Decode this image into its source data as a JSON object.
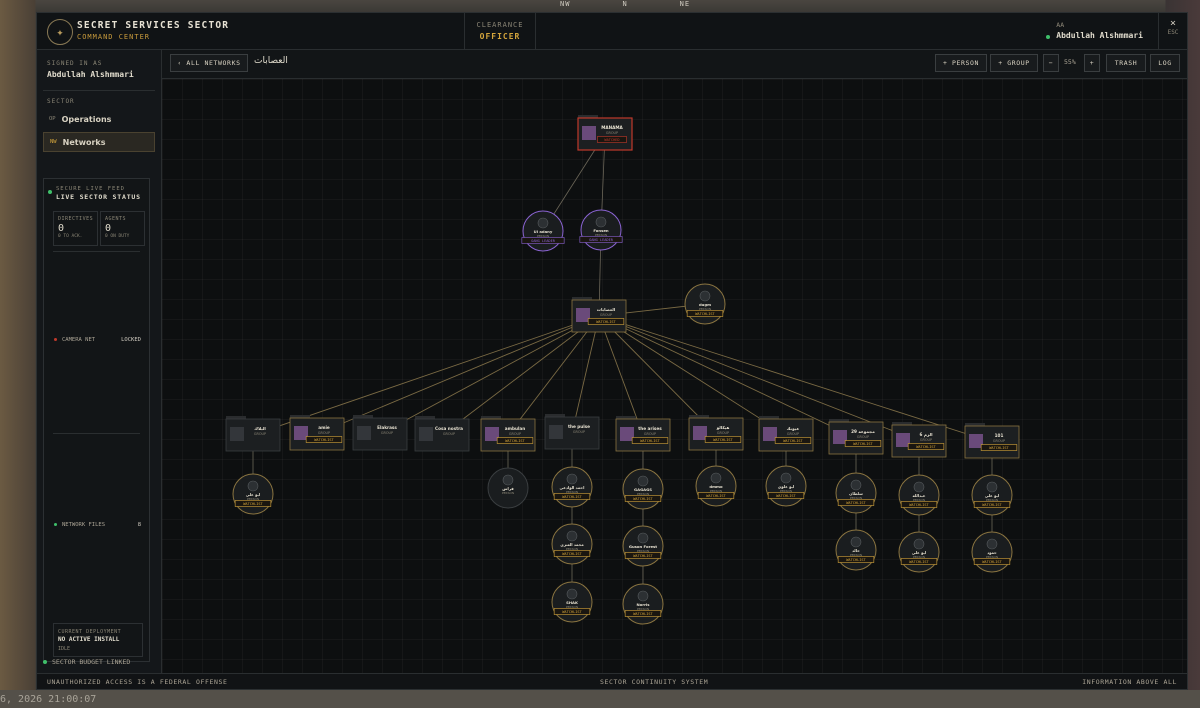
{
  "app": {
    "title": "SECRET SERVICES SECTOR",
    "subtitle": "COMMAND CENTER",
    "clearance_label": "CLEARANCE",
    "clearance_value": "OFFICER",
    "user_initials": "AA",
    "user_name": "Abdullah Alshmmari",
    "esc_label": "ESC",
    "close_glyph": "×"
  },
  "background": {
    "timestamp": "6, 2026 21:00:07",
    "compass": [
      "NW",
      "N",
      "NE"
    ]
  },
  "sidebar": {
    "signed_in_label": "SIGNED IN AS",
    "signed_in_name": "Abdullah Alshmmari",
    "sector_label": "SECTOR",
    "items": [
      {
        "icon": "OP",
        "label": "Operations"
      },
      {
        "icon": "NW",
        "label": "Networks"
      }
    ],
    "status": {
      "eyebrow": "SECURE LIVE FEED",
      "title": "LIVE SECTOR STATUS",
      "directives": {
        "label": "DIRECTIVES",
        "value": "0",
        "sub": "0 TO ACK."
      },
      "agents": {
        "label": "AGENTS",
        "value": "0",
        "sub": "0 ON DUTY"
      },
      "camera": {
        "label": "CAMERA NET",
        "value": "LOCKED"
      },
      "files": {
        "label": "NETWORK FILES",
        "value": "8"
      },
      "deploy": {
        "label": "CURRENT DEPLOYMENT",
        "value": "NO ACTIVE INSTALL",
        "sub": "IDLE"
      }
    },
    "budget": "SECTOR BUDGET LINKED"
  },
  "toolbar": {
    "all_networks": "‹ ALL NETWORKS",
    "crumb": "العصابات",
    "person": "+ PERSON",
    "group": "+ GROUP",
    "zoom_out": "−",
    "zoom": "55%",
    "zoom_in": "+",
    "trash": "TRASH",
    "log": "LOG"
  },
  "footer": {
    "left": "UNAUTHORIZED ACCESS IS A FEDERAL OFFENSE",
    "center": "SECTOR CONTINUITY SYSTEM",
    "right": "INFORMATION ABOVE ALL"
  },
  "colors": {
    "accent": "#d4a53b",
    "danger": "#c0392b",
    "leader": "#8a63d2",
    "ok": "#3fbf6a"
  },
  "graph": {
    "nodes": [
      {
        "id": "root",
        "kind": "group",
        "name": "MANAMA",
        "sub": "GROUP",
        "tag": "WATCHED",
        "red": true
      },
      {
        "id": "p1",
        "kind": "person",
        "name": "Ul adany",
        "sub": "PERSON",
        "tag": "GANG LEADER",
        "tagType": "leader"
      },
      {
        "id": "p2",
        "kind": "person",
        "name": "Fonsen",
        "sub": "PERSON",
        "tag": "GANG LEADER",
        "tagType": "leader"
      },
      {
        "id": "hub",
        "kind": "group",
        "name": "العصابات",
        "sub": "GROUP",
        "tag": "WATCHLIST"
      },
      {
        "id": "pr",
        "kind": "person",
        "name": "dugm",
        "sub": "PERSON",
        "tag": "WATCHLIST"
      },
      {
        "id": "g1",
        "kind": "group",
        "name": "البلاك",
        "sub": "GROUP",
        "tag": ""
      },
      {
        "id": "g2",
        "kind": "group",
        "name": "amie",
        "sub": "GROUP",
        "tag": "WATCHLIST"
      },
      {
        "id": "g3",
        "kind": "group",
        "name": "Elakrass",
        "sub": "GROUP",
        "tag": ""
      },
      {
        "id": "g4",
        "kind": "group",
        "name": "Cosa nostra",
        "sub": "GROUP",
        "tag": ""
      },
      {
        "id": "g5",
        "kind": "group",
        "name": "ambulan",
        "sub": "GROUP",
        "tag": "WATCHLIST"
      },
      {
        "id": "g6",
        "kind": "group",
        "name": "the pulse",
        "sub": "GROUP",
        "tag": ""
      },
      {
        "id": "g7",
        "kind": "group",
        "name": "the arises",
        "sub": "GROUP",
        "tag": "WATCHLIST"
      },
      {
        "id": "g8",
        "kind": "group",
        "name": "هيكالو",
        "sub": "GROUP",
        "tag": "WATCHLIST"
      },
      {
        "id": "g9",
        "kind": "group",
        "name": "عيونك",
        "sub": "GROUP",
        "tag": "WATCHLIST"
      },
      {
        "id": "g10",
        "kind": "group",
        "name": "مجموعة 29",
        "sub": "GROUP",
        "tag": "WATCHLIST"
      },
      {
        "id": "g11",
        "kind": "group",
        "name": "6 الرم",
        "sub": "GROUP",
        "tag": "WATCHLIST"
      },
      {
        "id": "g12",
        "kind": "group",
        "name": "101",
        "sub": "GROUP",
        "tag": "WATCHLIST"
      },
      {
        "id": "c1",
        "kind": "person",
        "name": "ابو علي",
        "sub": "PERSON",
        "tag": "WATCHLIST"
      },
      {
        "id": "c5",
        "kind": "person",
        "name": "فراس",
        "sub": "PERSON",
        "tag": ""
      },
      {
        "id": "c6a",
        "kind": "person",
        "name": "احمد الوادعي",
        "sub": "PERSON",
        "tag": "WATCHLIST"
      },
      {
        "id": "c6b",
        "kind": "person",
        "name": "محمد العنزي",
        "sub": "PERSON",
        "tag": "WATCHLIST"
      },
      {
        "id": "c6c",
        "kind": "person",
        "name": "SHAK",
        "sub": "PERSON",
        "tag": "WATCHLIST"
      },
      {
        "id": "c7a",
        "kind": "person",
        "name": "GAGAGS",
        "sub": "PERSON",
        "tag": "WATCHLIST"
      },
      {
        "id": "c7b",
        "kind": "person",
        "name": "Guson Forest",
        "sub": "PERSON",
        "tag": "WATCHLIST"
      },
      {
        "id": "c7c",
        "kind": "person",
        "name": "Norris",
        "sub": "PERSON",
        "tag": "WATCHLIST"
      },
      {
        "id": "c8",
        "kind": "person",
        "name": "dmmo",
        "sub": "PERSON",
        "tag": "WATCHLIST"
      },
      {
        "id": "c9",
        "kind": "person",
        "name": "ابو علوي",
        "sub": "PERSON",
        "tag": "WATCHLIST"
      },
      {
        "id": "c10a",
        "kind": "person",
        "name": "سلطان",
        "sub": "PERSON",
        "tag": "WATCHLIST"
      },
      {
        "id": "c10b",
        "kind": "person",
        "name": "خالد",
        "sub": "PERSON",
        "tag": "WATCHLIST"
      },
      {
        "id": "c11a",
        "kind": "person",
        "name": "عبدالله",
        "sub": "PERSON",
        "tag": "WATCHLIST"
      },
      {
        "id": "c11b",
        "kind": "person",
        "name": "ابو علي",
        "sub": "PERSON",
        "tag": "WATCHLIST"
      },
      {
        "id": "c12a",
        "kind": "person",
        "name": "ابو علي",
        "sub": "PERSON",
        "tag": "WATCHLIST"
      },
      {
        "id": "c12b",
        "kind": "person",
        "name": "حمود",
        "sub": "PERSON",
        "tag": "WATCHLIST"
      }
    ],
    "edges": [
      [
        "root",
        "p1"
      ],
      [
        "root",
        "p2"
      ],
      [
        "p2",
        "hub"
      ],
      [
        "hub",
        "pr"
      ],
      [
        "hub",
        "g1"
      ],
      [
        "hub",
        "g2"
      ],
      [
        "hub",
        "g3"
      ],
      [
        "hub",
        "g4"
      ],
      [
        "hub",
        "g5"
      ],
      [
        "hub",
        "g6"
      ],
      [
        "hub",
        "g7"
      ],
      [
        "hub",
        "g8"
      ],
      [
        "hub",
        "g9"
      ],
      [
        "hub",
        "g10"
      ],
      [
        "hub",
        "g11"
      ],
      [
        "hub",
        "g12"
      ],
      [
        "g1",
        "c1"
      ],
      [
        "g5",
        "c5"
      ],
      [
        "g6",
        "c6a"
      ],
      [
        "c6a",
        "c6b"
      ],
      [
        "c6b",
        "c6c"
      ],
      [
        "g7",
        "c7a"
      ],
      [
        "c7a",
        "c7b"
      ],
      [
        "c7b",
        "c7c"
      ],
      [
        "g8",
        "c8"
      ],
      [
        "g9",
        "c9"
      ],
      [
        "g10",
        "c10a"
      ],
      [
        "c10a",
        "c10b"
      ],
      [
        "g11",
        "c11a"
      ],
      [
        "c11a",
        "c11b"
      ],
      [
        "g12",
        "c12a"
      ],
      [
        "c12a",
        "c12b"
      ]
    ]
  }
}
